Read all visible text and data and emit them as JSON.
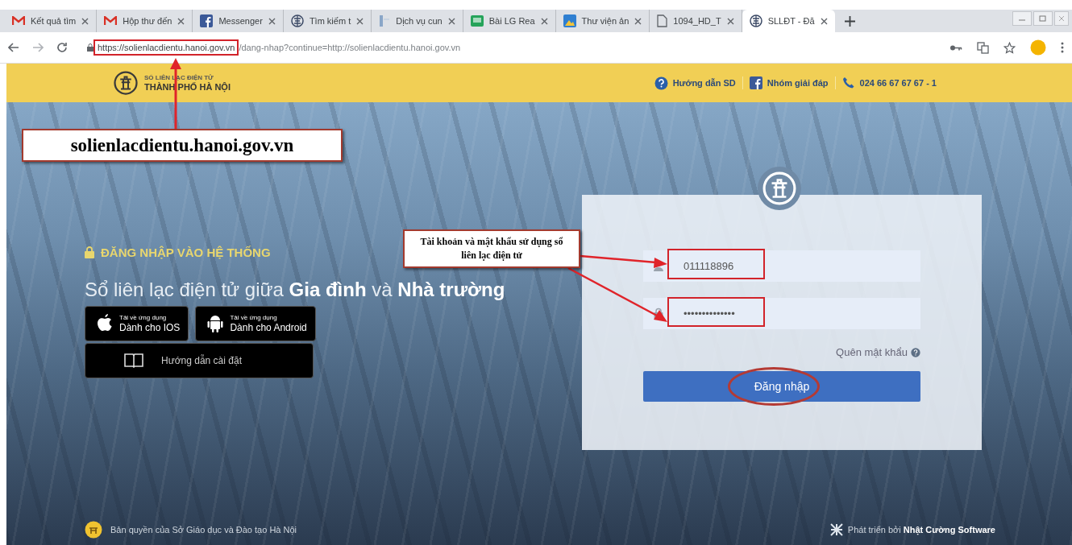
{
  "browser": {
    "tabs": [
      {
        "title": "Kết quả tìm",
        "kind": "gmail",
        "selected": false
      },
      {
        "title": "Hộp thư đến",
        "kind": "gmail",
        "selected": false
      },
      {
        "title": "Messenger",
        "kind": "facebook",
        "selected": false
      },
      {
        "title": "Tìm kiếm t",
        "kind": "globe",
        "selected": false
      },
      {
        "title": "Dịch vụ cun",
        "kind": "doc",
        "selected": false
      },
      {
        "title": "Bài LG Rea",
        "kind": "classroom",
        "selected": false
      },
      {
        "title": "Thư viện ản",
        "kind": "image",
        "selected": false
      },
      {
        "title": "1094_HD_T",
        "kind": "file",
        "selected": false
      },
      {
        "title": "SLLĐT - Đă",
        "kind": "globe",
        "selected": true
      }
    ],
    "address": {
      "host": "https://solienlacdientu.hanoi.gov.vn",
      "path": "/dang-nhap?continue=http://solienlacdientu.hanoi.gov.vn"
    }
  },
  "header": {
    "logo_caption": "SỔ LIÊN LẠC ĐIỆN TỬ",
    "logo_title": "THÀNH PHỐ HÀ NỘI",
    "links": [
      {
        "label": "Hướng dẫn SD",
        "kind": "help"
      },
      {
        "label": "Nhóm giải đáp",
        "kind": "facebook"
      },
      {
        "label": "024 66 67 67 67 - 1",
        "kind": "phone"
      }
    ]
  },
  "hero": {
    "section_title": "ĐĂNG NHẬP VÀO HỆ THỐNG",
    "headline": "Sổ liên lạc điện tử giữa **Gia đình** và **Nhà trường**",
    "app_buttons": [
      {
        "kind": "ios",
        "caption": "Tải về ứng dụng",
        "label": "Dành cho IOS"
      },
      {
        "kind": "android",
        "caption": "Tải về ứng dụng",
        "label": "Dành cho Android"
      }
    ],
    "guide_button": "Hướng dẫn cài đặt"
  },
  "login": {
    "username": {
      "value": "011118896"
    },
    "password": {
      "value": "••••••••••••••"
    },
    "forgot_link": "Quên mật khẩu",
    "submit": "Đăng nhập"
  },
  "footer": {
    "copyright": "Bản quyền của Sở Giáo dục và Đào tạo Hà Nội",
    "credit": "Phát triển bởi **Nhật Cường Software**"
  },
  "annotations": {
    "url_callout": "solienlacdientu.hanoi.gov.vn",
    "login_callout": "Tài khoản và mật khẩu sử dụng sổ liên lạc điện tử"
  }
}
